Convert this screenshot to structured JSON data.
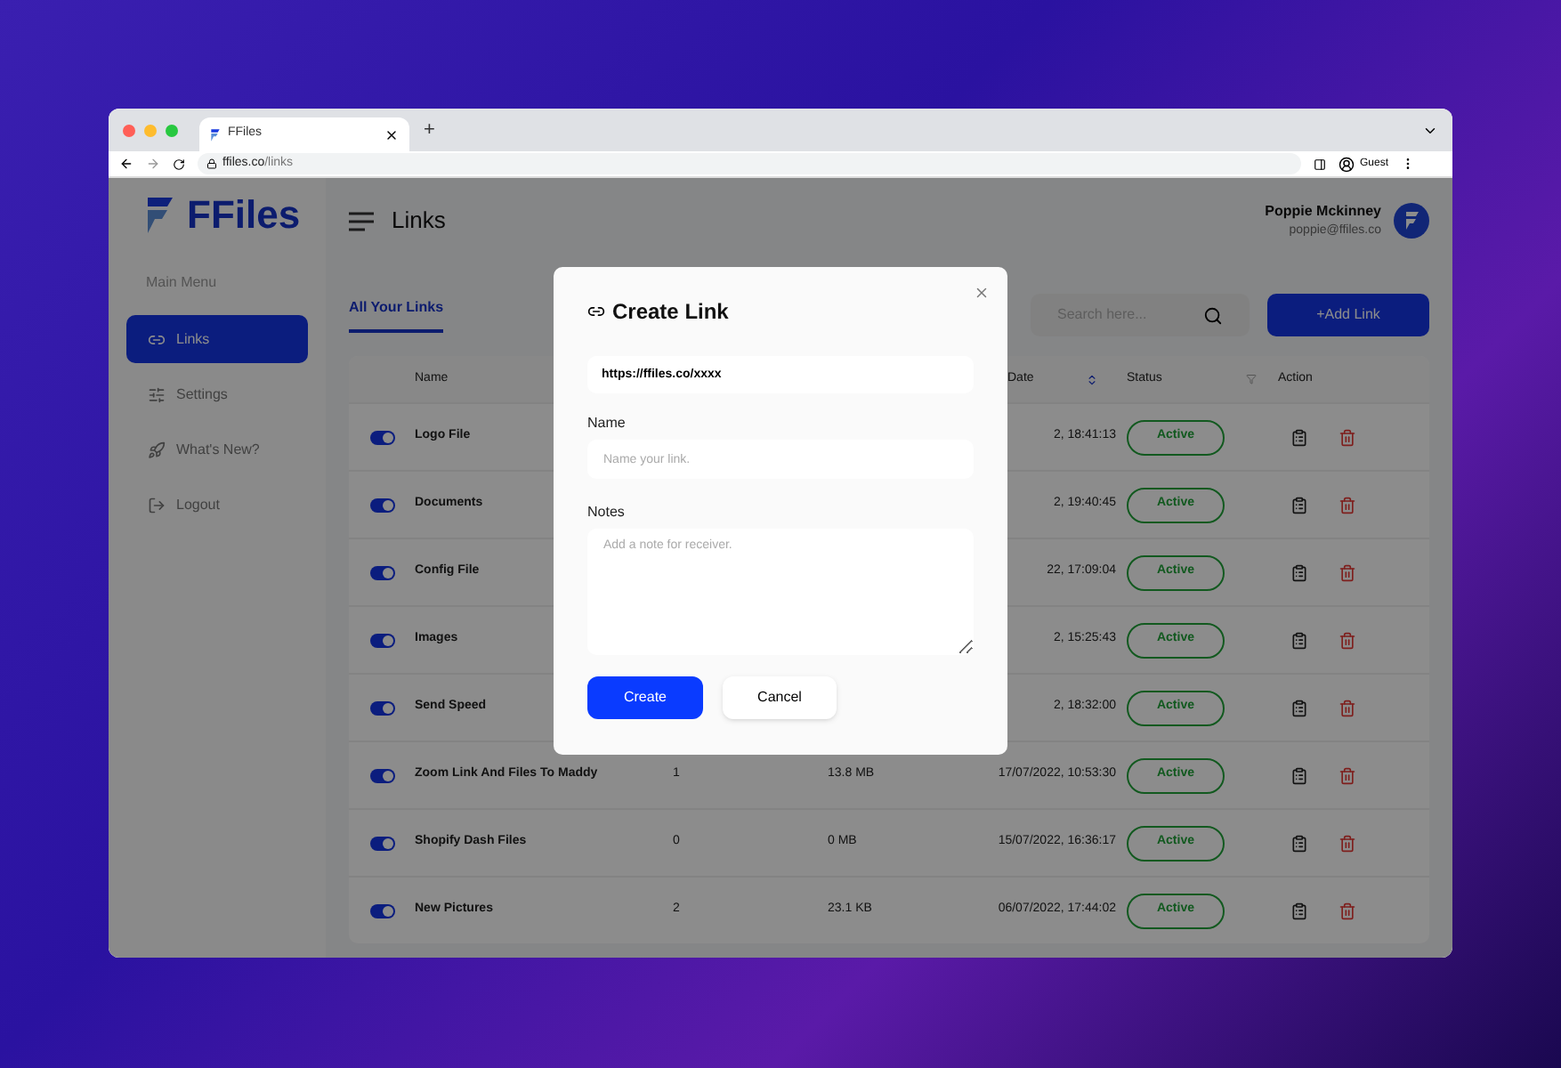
{
  "browser": {
    "tab_title": "FFiles",
    "new_tab": "+",
    "url_host": "ffiles.co",
    "url_path": "/links",
    "profile": "Guest"
  },
  "sidebar": {
    "logo": "FFiles",
    "section": "Main Menu",
    "items": [
      {
        "label": "Links",
        "selected": true
      },
      {
        "label": "Settings",
        "selected": false
      },
      {
        "label": "What's New?",
        "selected": false
      },
      {
        "label": "Logout",
        "selected": false
      }
    ]
  },
  "header": {
    "title": "Links",
    "user_name": "Poppie Mckinney",
    "user_email": "poppie@ffiles.co"
  },
  "tabs": [
    {
      "label": "All Your Links",
      "selected": true
    }
  ],
  "search": {
    "placeholder": "Search here..."
  },
  "add_button": "+Add Link",
  "table": {
    "columns": [
      "Name",
      "Date",
      "Status",
      "Action"
    ],
    "rows": [
      {
        "enabled": true,
        "name": "Logo File",
        "date": "2, 18:41:13",
        "status": "Active"
      },
      {
        "enabled": true,
        "name": "Documents",
        "date": "2, 19:40:45",
        "status": "Active"
      },
      {
        "enabled": true,
        "name": "Config File",
        "date": "22, 17:09:04",
        "status": "Active"
      },
      {
        "enabled": true,
        "name": "Images",
        "date": "2, 15:25:43",
        "status": "Active"
      },
      {
        "enabled": true,
        "name": "Send Speed",
        "date": "2, 18:32:00",
        "status": "Active"
      },
      {
        "enabled": true,
        "name": "Zoom Link And Files To Maddy",
        "count": "1",
        "size": "13.8 MB",
        "date": "17/07/2022, 10:53:30",
        "status": "Active"
      },
      {
        "enabled": true,
        "name": "Shopify Dash Files",
        "count": "0",
        "size": "0 MB",
        "date": "15/07/2022, 16:36:17",
        "status": "Active"
      },
      {
        "enabled": true,
        "name": "New Pictures",
        "count": "2",
        "size": "23.1 KB",
        "date": "06/07/2022, 17:44:02",
        "status": "Active"
      }
    ]
  },
  "modal": {
    "title": "Create Link",
    "url_value": "https://ffiles.co/xxxx",
    "name_label": "Name",
    "name_placeholder": "Name your link.",
    "notes_label": "Notes",
    "notes_placeholder": "Add a note for receiver.",
    "create": "Create",
    "cancel": "Cancel"
  }
}
